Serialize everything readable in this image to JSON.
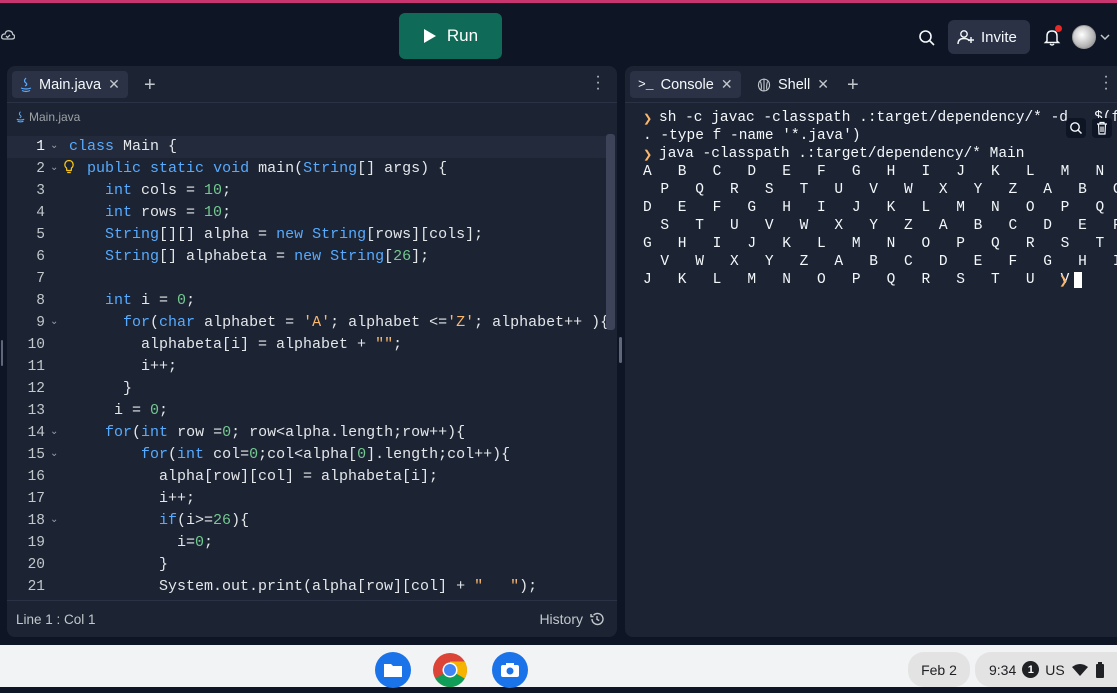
{
  "topbar": {
    "run_label": "Run",
    "invite_label": "Invite"
  },
  "editor": {
    "tab_label": "Main.java",
    "breadcrumb": "Main.java",
    "status": "Line 1 : Col 1",
    "history_label": "History",
    "lines": [
      {
        "n": "1",
        "code": "class Main {",
        "fold": true
      },
      {
        "n": "2",
        "code": "  public static void main(String[] args) {",
        "fold": true,
        "bulb": true
      },
      {
        "n": "3",
        "code": "    int cols = 10;"
      },
      {
        "n": "4",
        "code": "    int rows = 10;"
      },
      {
        "n": "5",
        "code": "    String[][] alpha = new String[rows][cols];"
      },
      {
        "n": "6",
        "code": "    String[] alphabeta = new String[26];"
      },
      {
        "n": "7",
        "code": ""
      },
      {
        "n": "8",
        "code": "    int i = 0;"
      },
      {
        "n": "9",
        "code": "      for(char alphabet = 'A'; alphabet <='Z'; alphabet++ ){",
        "fold": true
      },
      {
        "n": "10",
        "code": "        alphabeta[i] = alphabet + \"\";"
      },
      {
        "n": "11",
        "code": "        i++;"
      },
      {
        "n": "12",
        "code": "      }"
      },
      {
        "n": "13",
        "code": "     i = 0;"
      },
      {
        "n": "14",
        "code": "    for(int row =0; row<alpha.length;row++){",
        "fold": true
      },
      {
        "n": "15",
        "code": "        for(int col=0;col<alpha[0].length;col++){",
        "fold": true
      },
      {
        "n": "16",
        "code": "          alpha[row][col] = alphabeta[i];"
      },
      {
        "n": "17",
        "code": "          i++;"
      },
      {
        "n": "18",
        "code": "          if(i>=26){",
        "fold": true
      },
      {
        "n": "19",
        "code": "            i=0;"
      },
      {
        "n": "20",
        "code": "          }"
      },
      {
        "n": "21",
        "code": "          System.out.print(alpha[row][col] + \"   \");"
      }
    ]
  },
  "console": {
    "tab_console": "Console",
    "tab_shell": "Shell",
    "cmd1_a": "sh -c javac -classpath .:target/dependency/* -d . $(find",
    "cmd1_b": ". -type f -name '*.java')",
    "cmd2": "java -classpath .:target/dependency/* Main",
    "output": [
      "A   B   C   D   E   F   G   H   I   J   K   L   M   N   O",
      "  P   Q   R   S   T   U   V   W   X   Y   Z   A   B   C",
      "D   E   F   G   H   I   J   K   L   M   N   O   P   Q   R",
      "  S   T   U   V   W   X   Y   Z   A   B   C   D   E   F",
      "G   H   I   J   K   L   M   N   O   P   Q   R   S   T   U",
      "  V   W   X   Y   Z   A   B   C   D   E   F   G   H   I",
      "J   K   L   M   N   O   P   Q   R   S   T   U   V"
    ]
  },
  "shelf": {
    "date": "Feb 2",
    "time": "9:34",
    "notif_count": "1",
    "locale": "US"
  },
  "colors": {
    "run_button": "#0f6b57",
    "background": "#0e1525",
    "pane": "#1c2333",
    "accent_border": "#c7366f",
    "keyword": "#57abff",
    "string": "#f9b76f",
    "number": "#73c990"
  }
}
